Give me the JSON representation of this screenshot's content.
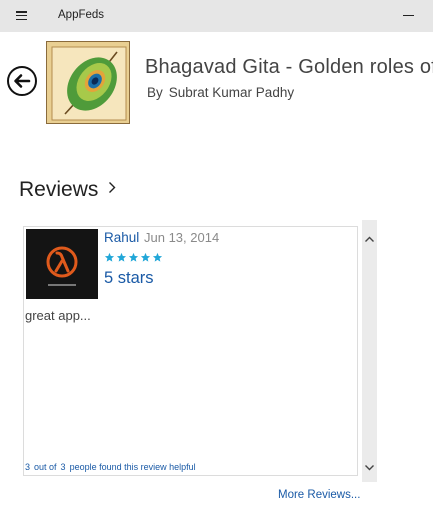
{
  "titlebar": {
    "app_name": "AppFeds"
  },
  "app": {
    "name": "Bhagavad Gita - Golden roles of",
    "by_label": "By",
    "developer": "Subrat Kumar Padhy"
  },
  "reviews": {
    "heading": "Reviews",
    "items": [
      {
        "reviewer": "Rahul",
        "date": "Jun 13, 2014",
        "rating": 5,
        "rating_text": "5 stars",
        "body": "great app...",
        "helpful": {
          "count": "3",
          "out_of_label": "out of",
          "total": "3",
          "suffix": "people found this review helpful"
        }
      }
    ],
    "more_label": "More Reviews..."
  },
  "colors": {
    "accent_link": "#1a5aa6",
    "star": "#22a7d8",
    "titlebar_bg": "#e6e6e6"
  },
  "icons": {
    "menu": "hamburger-icon",
    "minimize": "minimize-icon",
    "back": "back-arrow-icon",
    "chevron": "chevron-right-icon",
    "scroll_up": "chevron-up-icon",
    "scroll_down": "chevron-down-icon"
  }
}
